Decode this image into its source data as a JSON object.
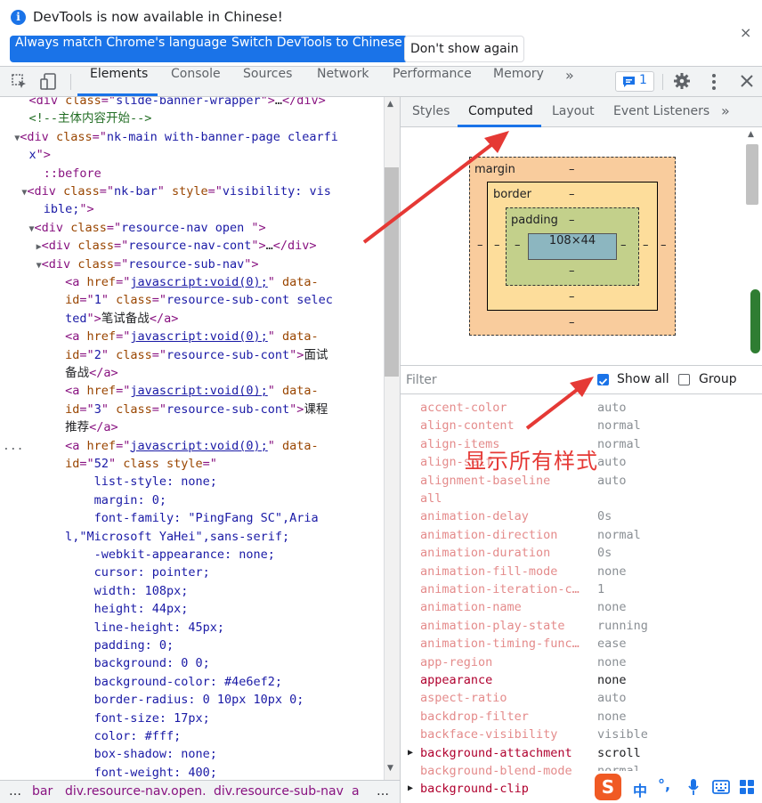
{
  "infobar": {
    "message": "DevTools is now available in Chinese!",
    "btn_match": "Always match Chrome's language",
    "btn_switch": "Switch DevTools to Chinese",
    "btn_dont_show": "Don't show again",
    "close": "×",
    "info_glyph": "i"
  },
  "toolbar": {
    "tabs": [
      "Elements",
      "Console",
      "Sources",
      "Network",
      "Performance",
      "Memory"
    ],
    "more": "»",
    "issues_count": "1"
  },
  "elements": {
    "lines": [
      {
        "ind": "    ",
        "tri": "",
        "html": [
          [
            "tag",
            "<div "
          ],
          [
            "attr",
            "class"
          ],
          [
            "tag",
            "=\""
          ],
          [
            "val",
            "slide-banner-wrapper"
          ],
          [
            "tag",
            "\">"
          ],
          [
            "txt",
            "…"
          ],
          [
            "tag",
            "</div>"
          ]
        ]
      },
      {
        "ind": "    ",
        "tri": "",
        "html": [
          [
            "cm",
            "<!--主体内容开始-->"
          ]
        ]
      },
      {
        "ind": "   ",
        "tri": "▼",
        "html": [
          [
            "tag",
            "<div "
          ],
          [
            "attr",
            "class"
          ],
          [
            "tag",
            "=\""
          ],
          [
            "val",
            "nk-main with-banner-page clearfi"
          ]
        ]
      },
      {
        "ind": "    ",
        "tri": "",
        "html": [
          [
            "val",
            "x"
          ],
          [
            "tag",
            "\">"
          ]
        ]
      },
      {
        "ind": "      ",
        "tri": "",
        "html": [
          [
            "pseudo",
            "::before"
          ]
        ]
      },
      {
        "ind": "    ",
        "tri": "▼",
        "html": [
          [
            "tag",
            "<div "
          ],
          [
            "attr",
            "class"
          ],
          [
            "tag",
            "=\""
          ],
          [
            "val",
            "nk-bar"
          ],
          [
            "tag",
            "\" "
          ],
          [
            "attr",
            "style"
          ],
          [
            "tag",
            "=\""
          ],
          [
            "val",
            "visibility: vis"
          ]
        ]
      },
      {
        "ind": "      ",
        "tri": "",
        "html": [
          [
            "val",
            "ible;"
          ],
          [
            "tag",
            "\">"
          ]
        ]
      },
      {
        "ind": "     ",
        "tri": "▼",
        "html": [
          [
            "tag",
            "<div "
          ],
          [
            "attr",
            "class"
          ],
          [
            "tag",
            "=\""
          ],
          [
            "val",
            "resource-nav open "
          ],
          [
            "tag",
            "\">"
          ]
        ]
      },
      {
        "ind": "      ",
        "tri": "▶",
        "html": [
          [
            "tag",
            "<div "
          ],
          [
            "attr",
            "class"
          ],
          [
            "tag",
            "=\""
          ],
          [
            "val",
            "resource-nav-cont"
          ],
          [
            "tag",
            "\">"
          ],
          [
            "txt",
            "…"
          ],
          [
            "tag",
            "</div>"
          ]
        ]
      },
      {
        "ind": "      ",
        "tri": "▼",
        "html": [
          [
            "tag",
            "<div "
          ],
          [
            "attr",
            "class"
          ],
          [
            "tag",
            "=\""
          ],
          [
            "val",
            "resource-sub-nav"
          ],
          [
            "tag",
            "\">"
          ]
        ]
      },
      {
        "ind": "         ",
        "tri": "",
        "html": [
          [
            "tag",
            "<a "
          ],
          [
            "attr",
            "href"
          ],
          [
            "tag",
            "=\""
          ],
          [
            "link",
            "javascript:void(0);"
          ],
          [
            "tag",
            "\" "
          ],
          [
            "attr",
            "data-"
          ]
        ]
      },
      {
        "ind": "         ",
        "tri": "",
        "html": [
          [
            "attr",
            "id"
          ],
          [
            "tag",
            "=\""
          ],
          [
            "val",
            "1"
          ],
          [
            "tag",
            "\" "
          ],
          [
            "attr",
            "class"
          ],
          [
            "tag",
            "=\""
          ],
          [
            "val",
            "resource-sub-cont selec"
          ]
        ]
      },
      {
        "ind": "         ",
        "tri": "",
        "html": [
          [
            "val",
            "ted"
          ],
          [
            "tag",
            "\">"
          ],
          [
            "txt",
            "笔试备战"
          ],
          [
            "tag",
            "</a>"
          ]
        ]
      },
      {
        "ind": "         ",
        "tri": "",
        "html": [
          [
            "tag",
            "<a "
          ],
          [
            "attr",
            "href"
          ],
          [
            "tag",
            "=\""
          ],
          [
            "link",
            "javascript:void(0);"
          ],
          [
            "tag",
            "\" "
          ],
          [
            "attr",
            "data-"
          ]
        ]
      },
      {
        "ind": "         ",
        "tri": "",
        "html": [
          [
            "attr",
            "id"
          ],
          [
            "tag",
            "=\""
          ],
          [
            "val",
            "2"
          ],
          [
            "tag",
            "\" "
          ],
          [
            "attr",
            "class"
          ],
          [
            "tag",
            "=\""
          ],
          [
            "val",
            "resource-sub-cont"
          ],
          [
            "tag",
            "\">"
          ],
          [
            "txt",
            "面试"
          ]
        ]
      },
      {
        "ind": "         ",
        "tri": "",
        "html": [
          [
            "txt",
            "备战"
          ],
          [
            "tag",
            "</a>"
          ]
        ]
      },
      {
        "ind": "         ",
        "tri": "",
        "html": [
          [
            "tag",
            "<a "
          ],
          [
            "attr",
            "href"
          ],
          [
            "tag",
            "=\""
          ],
          [
            "link",
            "javascript:void(0);"
          ],
          [
            "tag",
            "\" "
          ],
          [
            "attr",
            "data-"
          ]
        ]
      },
      {
        "ind": "         ",
        "tri": "",
        "html": [
          [
            "attr",
            "id"
          ],
          [
            "tag",
            "=\""
          ],
          [
            "val",
            "3"
          ],
          [
            "tag",
            "\" "
          ],
          [
            "attr",
            "class"
          ],
          [
            "tag",
            "=\""
          ],
          [
            "val",
            "resource-sub-cont"
          ],
          [
            "tag",
            "\">"
          ],
          [
            "txt",
            "课程"
          ]
        ]
      },
      {
        "ind": "         ",
        "tri": "",
        "html": [
          [
            "txt",
            "推荐"
          ],
          [
            "tag",
            "</a>"
          ]
        ]
      },
      {
        "ind": "         ",
        "tri": "",
        "html": [
          [
            "tag",
            "<a "
          ],
          [
            "attr",
            "href"
          ],
          [
            "tag",
            "=\""
          ],
          [
            "link",
            "javascript:void(0);"
          ],
          [
            "tag",
            "\" "
          ],
          [
            "attr",
            "data-"
          ]
        ]
      },
      {
        "ind": "         ",
        "tri": "",
        "html": [
          [
            "attr",
            "id"
          ],
          [
            "tag",
            "=\""
          ],
          [
            "val",
            "52"
          ],
          [
            "tag",
            "\" "
          ],
          [
            "attr",
            "class style"
          ],
          [
            "tag",
            "=\""
          ]
        ]
      },
      {
        "ind": "             ",
        "tri": "",
        "html": [
          [
            "val",
            "list-style: none;"
          ]
        ]
      },
      {
        "ind": "             ",
        "tri": "",
        "html": [
          [
            "val",
            "margin: 0;"
          ]
        ]
      },
      {
        "ind": "             ",
        "tri": "",
        "html": [
          [
            "val",
            "font-family: \"PingFang SC\",Aria"
          ]
        ]
      },
      {
        "ind": "         ",
        "tri": "",
        "html": [
          [
            "val",
            "l,\"Microsoft YaHei\",sans-serif;"
          ]
        ]
      },
      {
        "ind": "             ",
        "tri": "",
        "html": [
          [
            "val",
            "-webkit-appearance: none;"
          ]
        ]
      },
      {
        "ind": "             ",
        "tri": "",
        "html": [
          [
            "val",
            "cursor: pointer;"
          ]
        ]
      },
      {
        "ind": "             ",
        "tri": "",
        "html": [
          [
            "val",
            "width: 108px;"
          ]
        ]
      },
      {
        "ind": "             ",
        "tri": "",
        "html": [
          [
            "val",
            "height: 44px;"
          ]
        ]
      },
      {
        "ind": "             ",
        "tri": "",
        "html": [
          [
            "val",
            "line-height: 45px;"
          ]
        ]
      },
      {
        "ind": "             ",
        "tri": "",
        "html": [
          [
            "val",
            "padding: 0;"
          ]
        ]
      },
      {
        "ind": "             ",
        "tri": "",
        "html": [
          [
            "val",
            "background: 0 0;"
          ]
        ]
      },
      {
        "ind": "             ",
        "tri": "",
        "html": [
          [
            "val",
            "background-color: #4e6ef2;"
          ]
        ]
      },
      {
        "ind": "             ",
        "tri": "",
        "html": [
          [
            "val",
            "border-radius: 0 10px 10px 0;"
          ]
        ]
      },
      {
        "ind": "             ",
        "tri": "",
        "html": [
          [
            "val",
            "font-size: 17px;"
          ]
        ]
      },
      {
        "ind": "             ",
        "tri": "",
        "html": [
          [
            "val",
            "color: #fff;"
          ]
        ]
      },
      {
        "ind": "             ",
        "tri": "",
        "html": [
          [
            "val",
            "box-shadow: none;"
          ]
        ]
      },
      {
        "ind": "             ",
        "tri": "",
        "html": [
          [
            "val",
            "font-weight: 400;"
          ]
        ]
      }
    ],
    "selected_dots": "..."
  },
  "breadcrumb": {
    "dots_left": "…",
    "items": [
      "bar",
      "div.resource-nav.open.",
      "div.resource-sub-nav",
      "a"
    ],
    "dots_right": "…"
  },
  "sidebar_tabs": {
    "tabs": [
      "Styles",
      "Computed",
      "Layout",
      "Event Listeners"
    ],
    "more": "»"
  },
  "box_model": {
    "margin_label": "margin",
    "border_label": "border",
    "padding_label": "padding",
    "content": "108×44",
    "dash": "–"
  },
  "filter": {
    "placeholder": "Filter",
    "show_all_label": "Show all",
    "show_all_checked": true,
    "group_label": "Group",
    "group_checked": false
  },
  "properties": [
    {
      "name": "accent-color",
      "value": "auto",
      "set": false,
      "expandable": false
    },
    {
      "name": "align-content",
      "value": "normal",
      "set": false,
      "expandable": false
    },
    {
      "name": "align-items",
      "value": "normal",
      "set": false,
      "expandable": false
    },
    {
      "name": "align-self",
      "value": "auto",
      "set": false,
      "expandable": false
    },
    {
      "name": "alignment-baseline",
      "value": "auto",
      "set": false,
      "expandable": false
    },
    {
      "name": "all",
      "value": "",
      "set": false,
      "expandable": false
    },
    {
      "name": "animation-delay",
      "value": "0s",
      "set": false,
      "expandable": false
    },
    {
      "name": "animation-direction",
      "value": "normal",
      "set": false,
      "expandable": false
    },
    {
      "name": "animation-duration",
      "value": "0s",
      "set": false,
      "expandable": false
    },
    {
      "name": "animation-fill-mode",
      "value": "none",
      "set": false,
      "expandable": false
    },
    {
      "name": "animation-iteration-c…",
      "value": "1",
      "set": false,
      "expandable": false
    },
    {
      "name": "animation-name",
      "value": "none",
      "set": false,
      "expandable": false
    },
    {
      "name": "animation-play-state",
      "value": "running",
      "set": false,
      "expandable": false
    },
    {
      "name": "animation-timing-func…",
      "value": "ease",
      "set": false,
      "expandable": false
    },
    {
      "name": "app-region",
      "value": "none",
      "set": false,
      "expandable": false
    },
    {
      "name": "appearance",
      "value": "none",
      "set": true,
      "expandable": false
    },
    {
      "name": "aspect-ratio",
      "value": "auto",
      "set": false,
      "expandable": false
    },
    {
      "name": "backdrop-filter",
      "value": "none",
      "set": false,
      "expandable": false
    },
    {
      "name": "backface-visibility",
      "value": "visible",
      "set": false,
      "expandable": false
    },
    {
      "name": "background-attachment",
      "value": "scroll",
      "set": true,
      "expandable": true
    },
    {
      "name": "background-blend-mode",
      "value": "normal",
      "set": false,
      "expandable": false
    },
    {
      "name": "background-clip",
      "value": "",
      "set": true,
      "expandable": true
    }
  ],
  "annotation": {
    "text": "显示所有样式",
    "color": "#e53935"
  },
  "ime": {
    "logo": "S",
    "lang": "中",
    "punct": "°,"
  },
  "colors": {
    "accent": "#1a73e8",
    "margin": "#f9cc9d",
    "border": "#fddd9b",
    "padding": "#c3d08b",
    "content": "#8cb6c0"
  }
}
